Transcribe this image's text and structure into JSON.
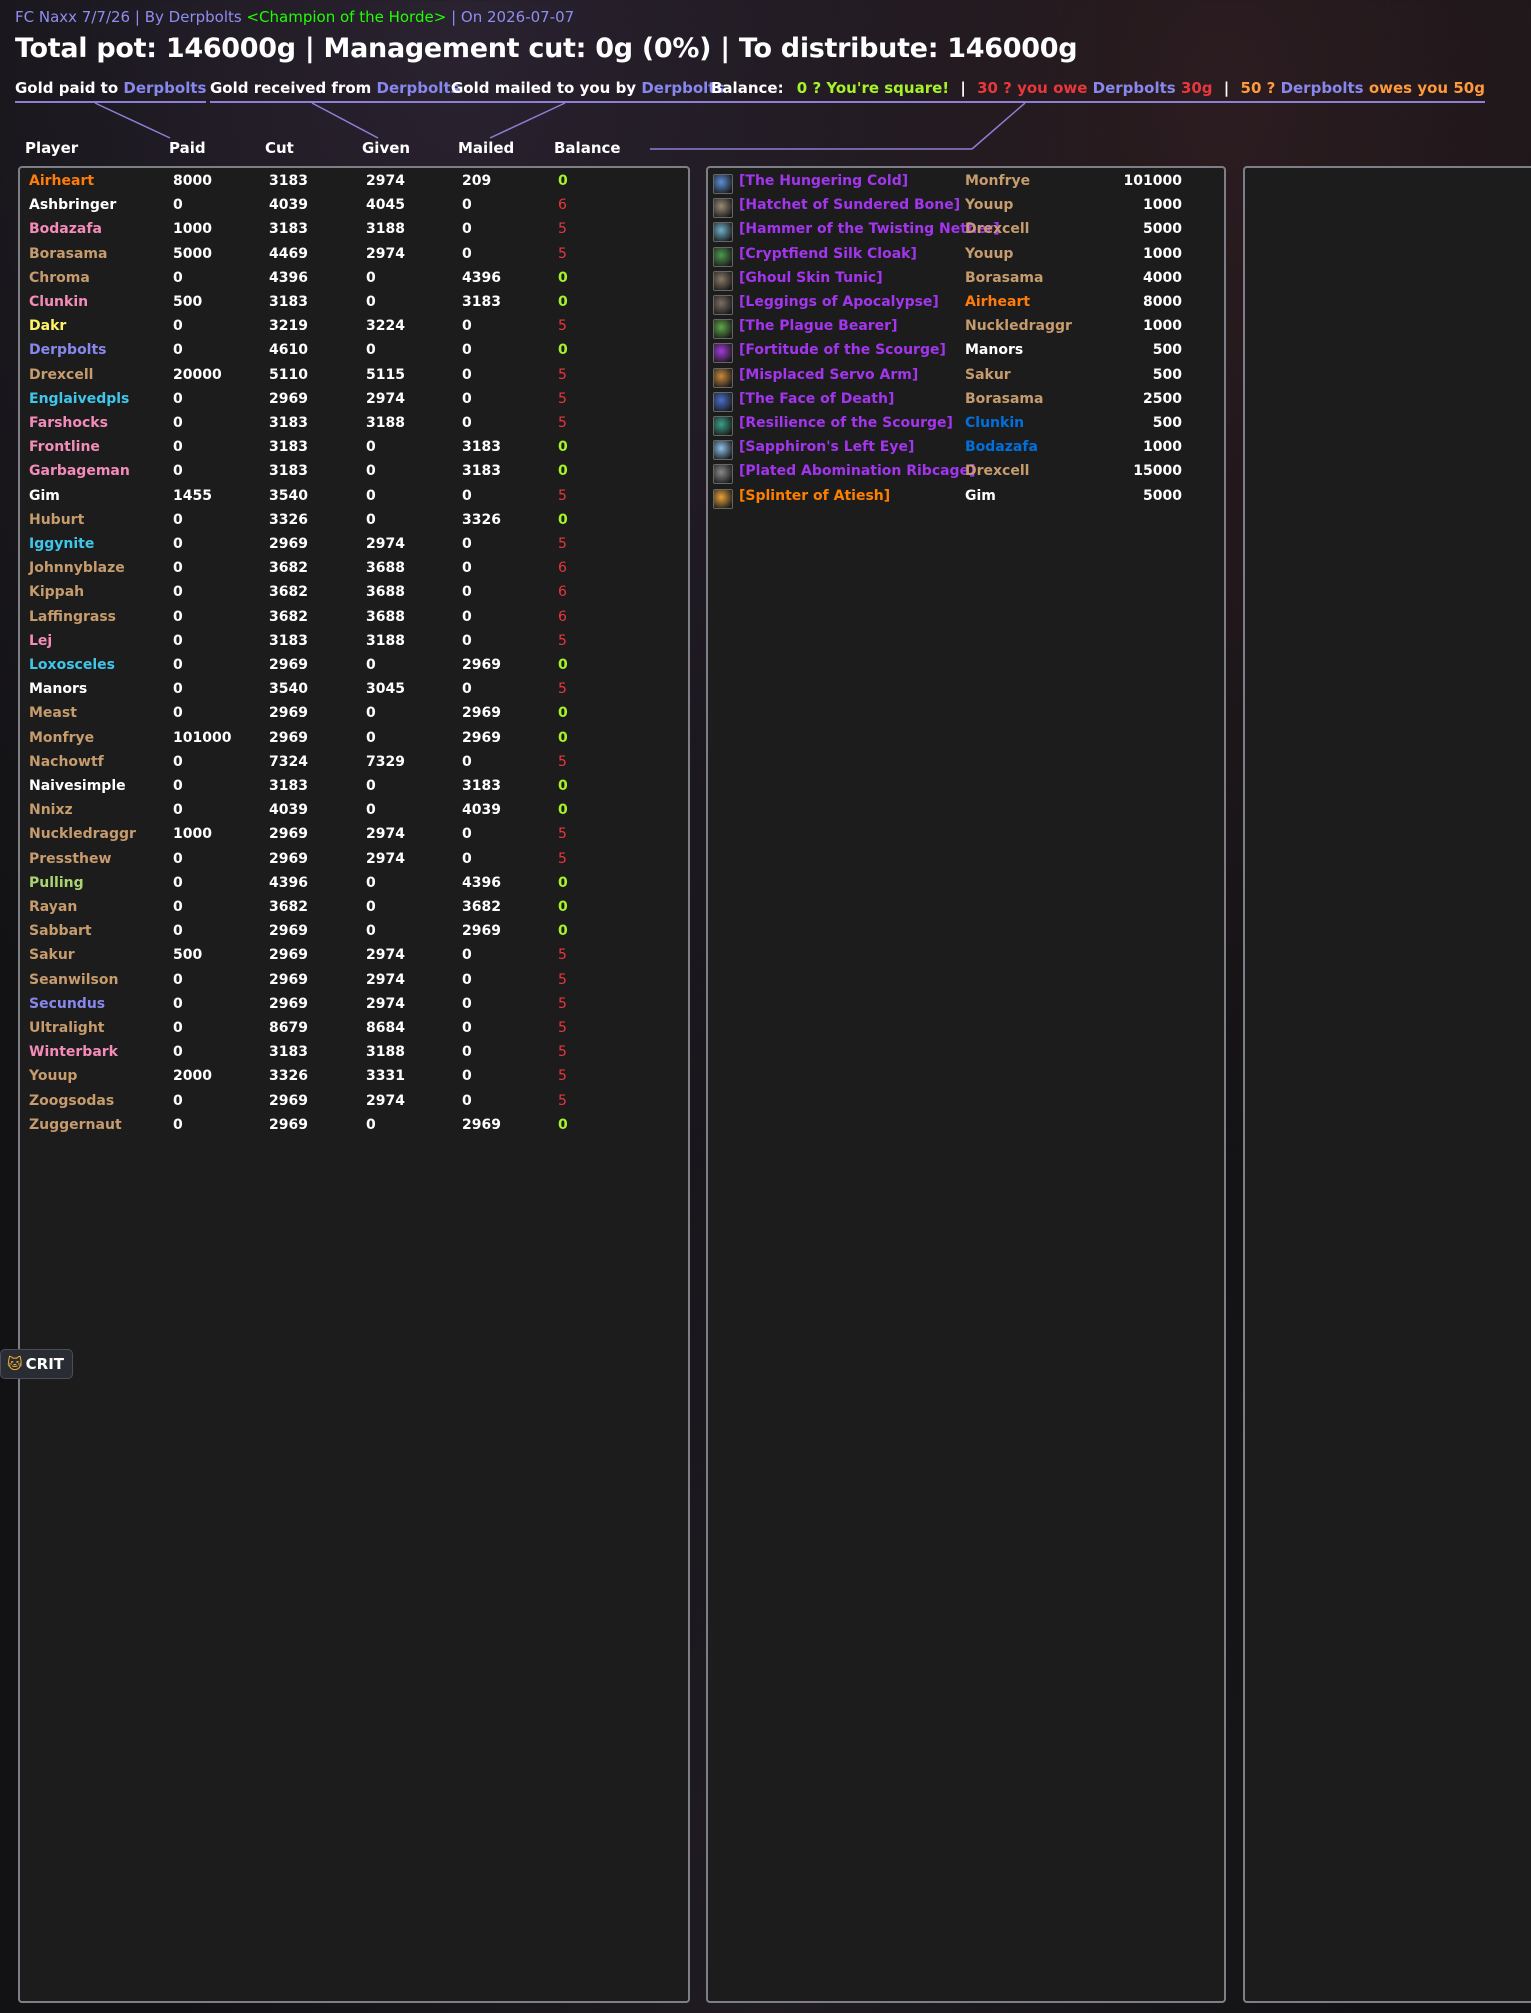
{
  "header": {
    "raid_title": "FC Naxx 7/7/26",
    "by_label": "By",
    "author": "Derpbolts",
    "guild": "<Champion of the Horde>",
    "on_label": "On",
    "date": "2026-07-07",
    "separator": "|",
    "headline": "Total pot: 146000g | Management cut: 0g (0%) | To distribute: 146000g"
  },
  "legend": {
    "paid_label": "Gold paid to",
    "paid_name": "Derpbolts",
    "received_label": "Gold received from",
    "received_name": "Derpbolts",
    "mailed_label": "Gold mailed to you by",
    "mailed_name": "Derpbolts",
    "balance_label": "Balance:",
    "square_text": "0 ? You're square!",
    "owe_prefix": "30 ? you owe",
    "owe_name": "Derpbolts",
    "owe_amount": "30g",
    "owed_prefix": "50 ?",
    "owed_name": "Derpbolts",
    "owed_suffix": "owes you 50g"
  },
  "columns": {
    "player": "Player",
    "paid": "Paid",
    "cut": "Cut",
    "given": "Given",
    "mailed": "Mailed",
    "balance": "Balance"
  },
  "colors": {
    "druid": "#ff7c0a",
    "paladin": "#f48cba",
    "warrior": "#c69b6d",
    "priest": "#ffffff",
    "mage": "#3fc7eb",
    "rogue": "#fff468",
    "warlock": "#8787ed",
    "hunter": "#aad372",
    "shaman": "#0070dd",
    "balance_zero": "#a6f32a",
    "balance_nonzero": "#e8373d",
    "epic": "#a335ee",
    "legendary": "#ff8000"
  },
  "players": [
    {
      "name": "Airheart",
      "class": "druid",
      "paid": "8000",
      "cut": "3183",
      "given": "2974",
      "mailed": "209",
      "balance": "0"
    },
    {
      "name": "Ashbringer",
      "class": "priest",
      "paid": "0",
      "cut": "4039",
      "given": "4045",
      "mailed": "0",
      "balance": "6"
    },
    {
      "name": "Bodazafa",
      "class": "paladin",
      "paid": "1000",
      "cut": "3183",
      "given": "3188",
      "mailed": "0",
      "balance": "5"
    },
    {
      "name": "Borasama",
      "class": "warrior",
      "paid": "5000",
      "cut": "4469",
      "given": "2974",
      "mailed": "0",
      "balance": "5"
    },
    {
      "name": "Chroma",
      "class": "warrior",
      "paid": "0",
      "cut": "4396",
      "given": "0",
      "mailed": "4396",
      "balance": "0"
    },
    {
      "name": "Clunkin",
      "class": "paladin",
      "paid": "500",
      "cut": "3183",
      "given": "0",
      "mailed": "3183",
      "balance": "0"
    },
    {
      "name": "Dakr",
      "class": "rogue",
      "paid": "0",
      "cut": "3219",
      "given": "3224",
      "mailed": "0",
      "balance": "5"
    },
    {
      "name": "Derpbolts",
      "class": "warlock",
      "paid": "0",
      "cut": "4610",
      "given": "0",
      "mailed": "0",
      "balance": "0"
    },
    {
      "name": "Drexcell",
      "class": "warrior",
      "paid": "20000",
      "cut": "5110",
      "given": "5115",
      "mailed": "0",
      "balance": "5"
    },
    {
      "name": "Englaivedpls",
      "class": "mage",
      "paid": "0",
      "cut": "2969",
      "given": "2974",
      "mailed": "0",
      "balance": "5"
    },
    {
      "name": "Farshocks",
      "class": "paladin",
      "paid": "0",
      "cut": "3183",
      "given": "3188",
      "mailed": "0",
      "balance": "5"
    },
    {
      "name": "Frontline",
      "class": "paladin",
      "paid": "0",
      "cut": "3183",
      "given": "0",
      "mailed": "3183",
      "balance": "0"
    },
    {
      "name": "Garbageman",
      "class": "paladin",
      "paid": "0",
      "cut": "3183",
      "given": "0",
      "mailed": "3183",
      "balance": "0"
    },
    {
      "name": "Gim",
      "class": "priest",
      "paid": "1455",
      "cut": "3540",
      "given": "0",
      "mailed": "0",
      "balance": "5"
    },
    {
      "name": "Huburt",
      "class": "warrior",
      "paid": "0",
      "cut": "3326",
      "given": "0",
      "mailed": "3326",
      "balance": "0"
    },
    {
      "name": "Iggynite",
      "class": "mage",
      "paid": "0",
      "cut": "2969",
      "given": "2974",
      "mailed": "0",
      "balance": "5"
    },
    {
      "name": "Johnnyblaze",
      "class": "warrior",
      "paid": "0",
      "cut": "3682",
      "given": "3688",
      "mailed": "0",
      "balance": "6"
    },
    {
      "name": "Kippah",
      "class": "warrior",
      "paid": "0",
      "cut": "3682",
      "given": "3688",
      "mailed": "0",
      "balance": "6"
    },
    {
      "name": "Laffingrass",
      "class": "warrior",
      "paid": "0",
      "cut": "3682",
      "given": "3688",
      "mailed": "0",
      "balance": "6"
    },
    {
      "name": "Lej",
      "class": "paladin",
      "paid": "0",
      "cut": "3183",
      "given": "3188",
      "mailed": "0",
      "balance": "5"
    },
    {
      "name": "Loxosceles",
      "class": "mage",
      "paid": "0",
      "cut": "2969",
      "given": "0",
      "mailed": "2969",
      "balance": "0"
    },
    {
      "name": "Manors",
      "class": "priest",
      "paid": "0",
      "cut": "3540",
      "given": "3045",
      "mailed": "0",
      "balance": "5"
    },
    {
      "name": "Meast",
      "class": "warrior",
      "paid": "0",
      "cut": "2969",
      "given": "0",
      "mailed": "2969",
      "balance": "0"
    },
    {
      "name": "Monfrye",
      "class": "warrior",
      "paid": "101000",
      "cut": "2969",
      "given": "0",
      "mailed": "2969",
      "balance": "0"
    },
    {
      "name": "Nachowtf",
      "class": "warrior",
      "paid": "0",
      "cut": "7324",
      "given": "7329",
      "mailed": "0",
      "balance": "5"
    },
    {
      "name": "Naivesimple",
      "class": "priest",
      "paid": "0",
      "cut": "3183",
      "given": "0",
      "mailed": "3183",
      "balance": "0"
    },
    {
      "name": "Nnixz",
      "class": "warrior",
      "paid": "0",
      "cut": "4039",
      "given": "0",
      "mailed": "4039",
      "balance": "0"
    },
    {
      "name": "Nuckledraggr",
      "class": "warrior",
      "paid": "1000",
      "cut": "2969",
      "given": "2974",
      "mailed": "0",
      "balance": "5"
    },
    {
      "name": "Pressthew",
      "class": "warrior",
      "paid": "0",
      "cut": "2969",
      "given": "2974",
      "mailed": "0",
      "balance": "5"
    },
    {
      "name": "Pulling",
      "class": "hunter",
      "paid": "0",
      "cut": "4396",
      "given": "0",
      "mailed": "4396",
      "balance": "0"
    },
    {
      "name": "Rayan",
      "class": "warrior",
      "paid": "0",
      "cut": "3682",
      "given": "0",
      "mailed": "3682",
      "balance": "0"
    },
    {
      "name": "Sabbart",
      "class": "warrior",
      "paid": "0",
      "cut": "2969",
      "given": "0",
      "mailed": "2969",
      "balance": "0"
    },
    {
      "name": "Sakur",
      "class": "warrior",
      "paid": "500",
      "cut": "2969",
      "given": "2974",
      "mailed": "0",
      "balance": "5"
    },
    {
      "name": "Seanwilson",
      "class": "warrior",
      "paid": "0",
      "cut": "2969",
      "given": "2974",
      "mailed": "0",
      "balance": "5"
    },
    {
      "name": "Secundus",
      "class": "warlock",
      "paid": "0",
      "cut": "2969",
      "given": "2974",
      "mailed": "0",
      "balance": "5"
    },
    {
      "name": "Ultralight",
      "class": "warrior",
      "paid": "0",
      "cut": "8679",
      "given": "8684",
      "mailed": "0",
      "balance": "5"
    },
    {
      "name": "Winterbark",
      "class": "paladin",
      "paid": "0",
      "cut": "3183",
      "given": "3188",
      "mailed": "0",
      "balance": "5"
    },
    {
      "name": "Youup",
      "class": "warrior",
      "paid": "2000",
      "cut": "3326",
      "given": "3331",
      "mailed": "0",
      "balance": "5"
    },
    {
      "name": "Zoogsodas",
      "class": "warrior",
      "paid": "0",
      "cut": "2969",
      "given": "2974",
      "mailed": "0",
      "balance": "5"
    },
    {
      "name": "Zuggernaut",
      "class": "warrior",
      "paid": "0",
      "cut": "2969",
      "given": "0",
      "mailed": "2969",
      "balance": "0"
    }
  ],
  "loot": [
    {
      "item": "[The Hungering Cold]",
      "quality": "epic",
      "icon": "frost-orb-icon",
      "icon_color": "#5d8fd6",
      "winner": "Monfrye",
      "winner_class": "warrior",
      "price": "101000"
    },
    {
      "item": "[Hatchet of Sundered Bone]",
      "quality": "epic",
      "icon": "axe-icon",
      "icon_color": "#9a8a78",
      "winner": "Youup",
      "winner_class": "warrior",
      "price": "1000"
    },
    {
      "item": "[Hammer of the Twisting Nether]",
      "quality": "epic",
      "icon": "mace-icon",
      "icon_color": "#6fb0c8",
      "winner": "Drexcell",
      "winner_class": "warrior",
      "price": "5000"
    },
    {
      "item": "[Cryptfiend Silk Cloak]",
      "quality": "epic",
      "icon": "cloak-icon",
      "icon_color": "#4e9a4e",
      "winner": "Youup",
      "winner_class": "warrior",
      "price": "1000"
    },
    {
      "item": "[Ghoul Skin Tunic]",
      "quality": "epic",
      "icon": "tunic-icon",
      "icon_color": "#8a7a66",
      "winner": "Borasama",
      "winner_class": "warrior",
      "price": "4000"
    },
    {
      "item": "[Leggings of Apocalypse]",
      "quality": "epic",
      "icon": "leggings-icon",
      "icon_color": "#7a6e66",
      "winner": "Airheart",
      "winner_class": "druid",
      "price": "8000"
    },
    {
      "item": "[The Plague Bearer]",
      "quality": "epic",
      "icon": "shield-icon",
      "icon_color": "#5fa84a",
      "winner": "Nuckledraggr",
      "winner_class": "warrior",
      "price": "1000"
    },
    {
      "item": "[Fortitude of the Scourge]",
      "quality": "epic",
      "icon": "shoulder-rune-icon",
      "icon_color": "#a23bd6",
      "winner": "Manors",
      "winner_class": "priest",
      "price": "500"
    },
    {
      "item": "[Misplaced Servo Arm]",
      "quality": "epic",
      "icon": "servo-arm-icon",
      "icon_color": "#c88a3a",
      "winner": "Sakur",
      "winner_class": "warrior",
      "price": "500"
    },
    {
      "item": "[The Face of Death]",
      "quality": "epic",
      "icon": "skull-shield-icon",
      "icon_color": "#4a6fc8",
      "winner": "Borasama",
      "winner_class": "warrior",
      "price": "2500"
    },
    {
      "item": "[Resilience of the Scourge]",
      "quality": "epic",
      "icon": "shoulder-rune-icon",
      "icon_color": "#3aa08a",
      "winner": "Clunkin",
      "winner_class": "shaman",
      "price": "500"
    },
    {
      "item": "[Sapphiron's Left Eye]",
      "quality": "epic",
      "icon": "frost-eye-icon",
      "icon_color": "#8ec0e8",
      "winner": "Bodazafa",
      "winner_class": "shaman",
      "price": "1000"
    },
    {
      "item": "[Plated Abomination Ribcage]",
      "quality": "epic",
      "icon": "ribcage-icon",
      "icon_color": "#888888",
      "winner": "Drexcell",
      "winner_class": "warrior",
      "price": "15000"
    },
    {
      "item": "[Splinter of Atiesh]",
      "quality": "legendary",
      "icon": "splinter-icon",
      "icon_color": "#e8a23a",
      "winner": "Gim",
      "winner_class": "priest",
      "price": "5000"
    }
  ],
  "overlay": {
    "crit_label": "CRIT",
    "crit_icon": "cat-icon"
  }
}
